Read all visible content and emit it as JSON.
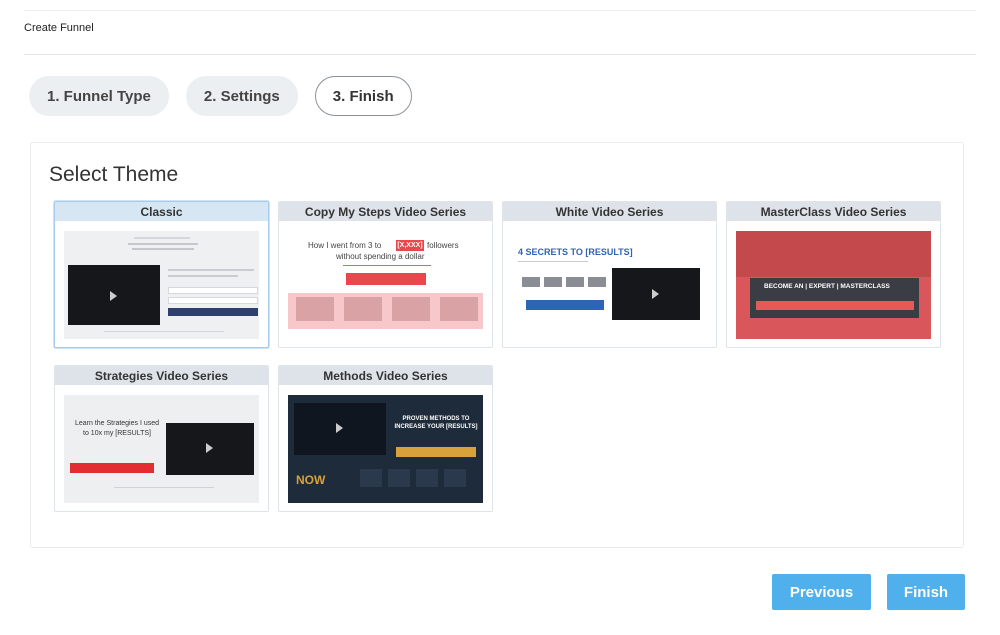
{
  "header": {
    "title": "Create Funnel"
  },
  "steps": [
    {
      "label": "1. Funnel Type",
      "active": false
    },
    {
      "label": "2. Settings",
      "active": false
    },
    {
      "label": "3. Finish",
      "active": true
    }
  ],
  "theme_panel": {
    "title": "Select Theme",
    "selected": "Classic",
    "themes": [
      {
        "name": "Classic"
      },
      {
        "name": "Copy My Steps Video Series",
        "thumb_text": "How I went from 3 to",
        "thumb_text_2": "without spending a dollar",
        "thumb_highlight": "[X,XXX]",
        "thumb_highlight_2": "followers"
      },
      {
        "name": "White Video Series",
        "thumb_text": "4 SECRETS TO [RESULTS]"
      },
      {
        "name": "MasterClass Video Series",
        "thumb_text": "BECOME AN | EXPERT | MASTERCLASS"
      },
      {
        "name": "Strategies Video Series",
        "thumb_text": "Learn the Strategies I used to 10x my [RESULTS]"
      },
      {
        "name": "Methods Video Series",
        "thumb_text": "PROVEN METHODS TO INCREASE YOUR [RESULTS]",
        "thumb_text_2": "NOW"
      }
    ]
  },
  "actions": {
    "previous_label": "Previous",
    "finish_label": "Finish"
  },
  "colors": {
    "accent": "#4fb0ec",
    "pill_bg": "#eceff1",
    "card_header": "#dde3e8",
    "red": "#e8474b",
    "navy": "#1d2b3a",
    "gold": "#d8a13c"
  }
}
